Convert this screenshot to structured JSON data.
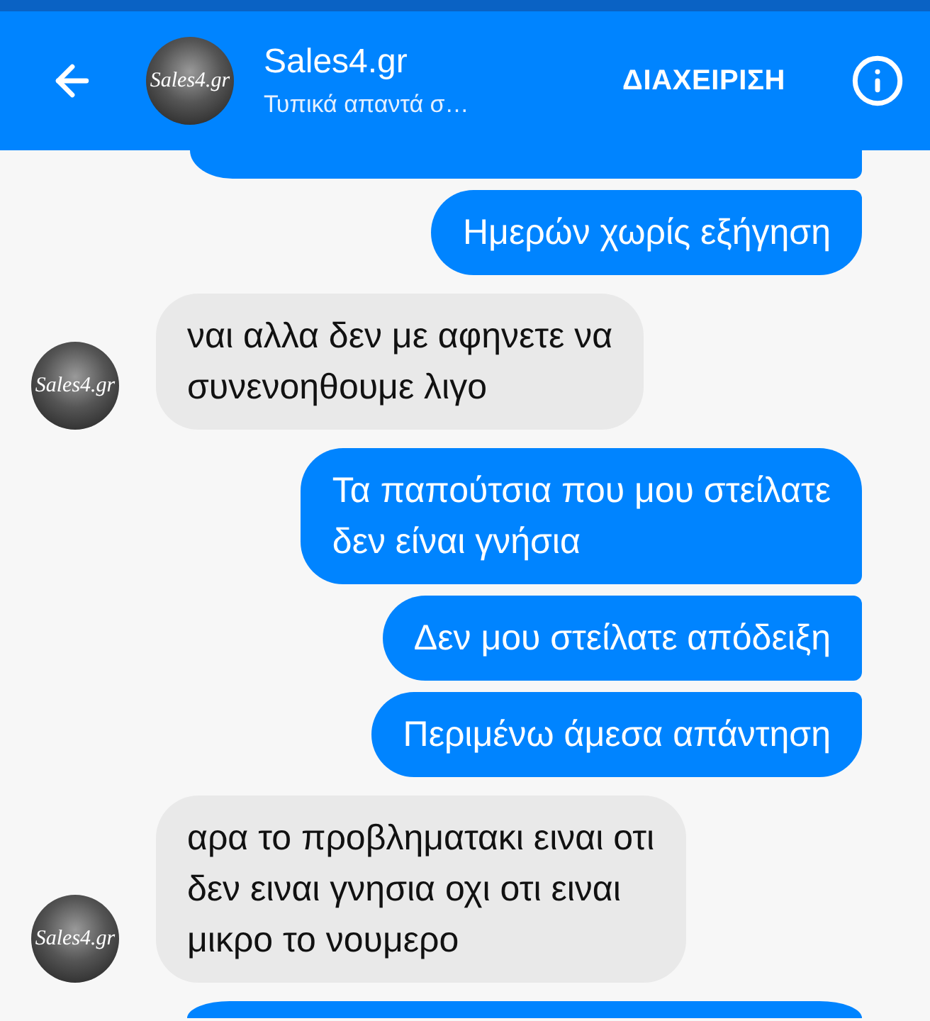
{
  "header": {
    "avatar": {
      "logo_text": "Sales4.gr"
    },
    "title": "Sales4.gr",
    "subtitle": "Τυπικά απαντά σ…",
    "action": "ΔΙΑΧΕΙΡΙΣΗ"
  },
  "messages": [
    {
      "kind": "top_edge",
      "outgoing": true
    },
    {
      "kind": "text",
      "outgoing": true,
      "lines": [
        "Ημερών χωρίς εξήγηση"
      ]
    },
    {
      "kind": "text",
      "outgoing": false,
      "avatar": {
        "logo_text": "Sales4.gr"
      },
      "lines": [
        "ναι αλλα δεν με αφηνετε να",
        "συνενοηθουμε λιγο"
      ]
    },
    {
      "kind": "text",
      "outgoing": true,
      "lines": [
        "Τα παπούτσια που μου στείλατε",
        "δεν είναι γνήσια"
      ]
    },
    {
      "kind": "text",
      "outgoing": true,
      "lines": [
        "Δεν μου στείλατε απόδειξη"
      ]
    },
    {
      "kind": "text",
      "outgoing": true,
      "lines": [
        "Περιμένω άμεσα απάντηση"
      ]
    },
    {
      "kind": "text",
      "outgoing": false,
      "avatar": {
        "logo_text": "Sales4.gr"
      },
      "lines": [
        "αρα το προβληματακι ειναι οτι",
        "δεν ειναι γνησια οχι οτι ειναι",
        "μικρο το νουμερο"
      ]
    },
    {
      "kind": "bottom_edge",
      "outgoing": true
    }
  ]
}
